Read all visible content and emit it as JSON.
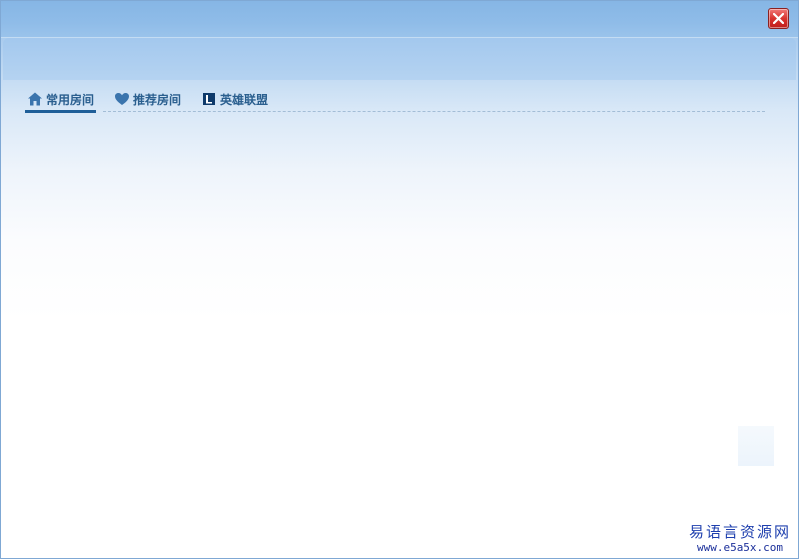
{
  "window": {
    "title": ""
  },
  "tabs": [
    {
      "label": "常用房间",
      "icon": "home-icon",
      "active": true
    },
    {
      "label": "推荐房间",
      "icon": "heart-icon",
      "active": false
    },
    {
      "label": "英雄联盟",
      "icon": "league-icon",
      "active": false
    }
  ],
  "watermark": {
    "chinese": "易语言资源网",
    "url": "www.e5a5x.com"
  },
  "colors": {
    "titlebar": "#86b6e5",
    "accent": "#1f5f99",
    "close_red": "#d8332f",
    "tab_text": "#2a5f8f"
  }
}
